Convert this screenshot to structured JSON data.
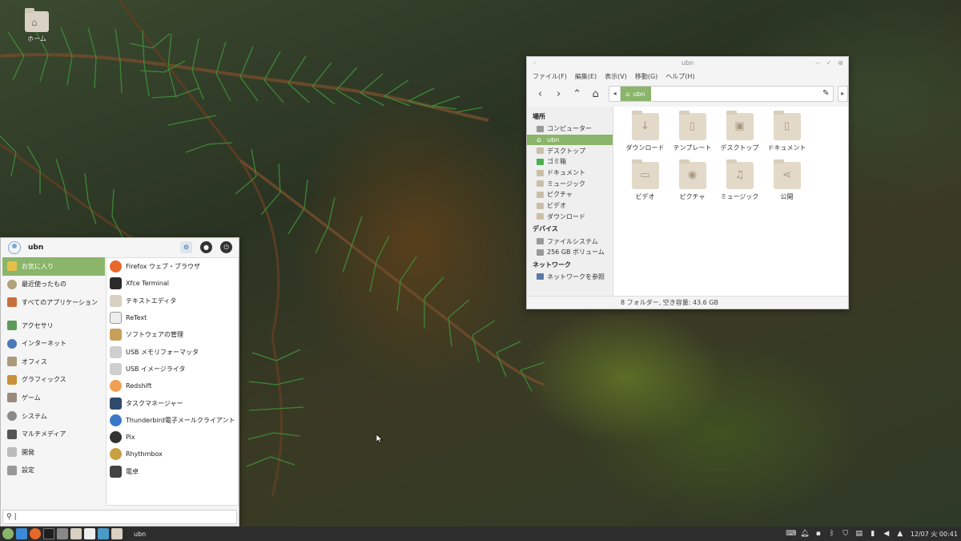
{
  "desktop": {
    "home_icon_label": "ホーム"
  },
  "file_manager": {
    "title": "ubn",
    "menu": [
      "ファイル(F)",
      "編集(E)",
      "表示(V)",
      "移動(G)",
      "ヘルプ(H)"
    ],
    "path_crumb": "ubn",
    "sidebar": {
      "places_header": "場所",
      "places": [
        "コンピューター",
        "ubn",
        "デスクトップ",
        "ゴミ箱",
        "ドキュメント",
        "ミュージック",
        "ピクチャ",
        "ビデオ",
        "ダウンロード"
      ],
      "devices_header": "デバイス",
      "devices": [
        "ファイルシステム",
        "256 GB ボリューム"
      ],
      "network_header": "ネットワーク",
      "network": [
        "ネットワークを参照"
      ]
    },
    "folders": [
      {
        "label": "ダウンロード",
        "icon": "download-icon"
      },
      {
        "label": "テンプレート",
        "icon": "template-icon"
      },
      {
        "label": "デスクトップ",
        "icon": "desktop-icon"
      },
      {
        "label": "ドキュメント",
        "icon": "document-icon"
      },
      {
        "label": "ビデオ",
        "icon": "video-icon"
      },
      {
        "label": "ピクチャ",
        "icon": "camera-icon"
      },
      {
        "label": "ミュージック",
        "icon": "music-icon"
      },
      {
        "label": "公開",
        "icon": "share-icon"
      }
    ],
    "status": "8 フォルダー, 空き容量: 43.6 GB"
  },
  "whisker_menu": {
    "username": "ubn",
    "categories": [
      "お気に入り",
      "最近使ったもの",
      "すべてのアプリケーション",
      "アクセサリ",
      "インターネット",
      "オフィス",
      "グラフィックス",
      "ゲーム",
      "システム",
      "マルチメディア",
      "開発",
      "設定"
    ],
    "apps": [
      "Firefox ウェブ・ブラウザ",
      "Xfce Terminal",
      "テキストエディタ",
      "ReText",
      "ソフトウェアの管理",
      "USB メモリフォーマッタ",
      "USB イメージライタ",
      "Redshift",
      "タスクマネージャー",
      "Thunderbird電子メールクライアント",
      "Pix",
      "Rhythmbox",
      "電卓"
    ],
    "search_value": "|"
  },
  "taskbar": {
    "task_label": "ubn",
    "clock": "12/07 火 00:41"
  },
  "colors": {
    "accent": "#8ab56a",
    "taskbar": "#2d2d2d"
  }
}
